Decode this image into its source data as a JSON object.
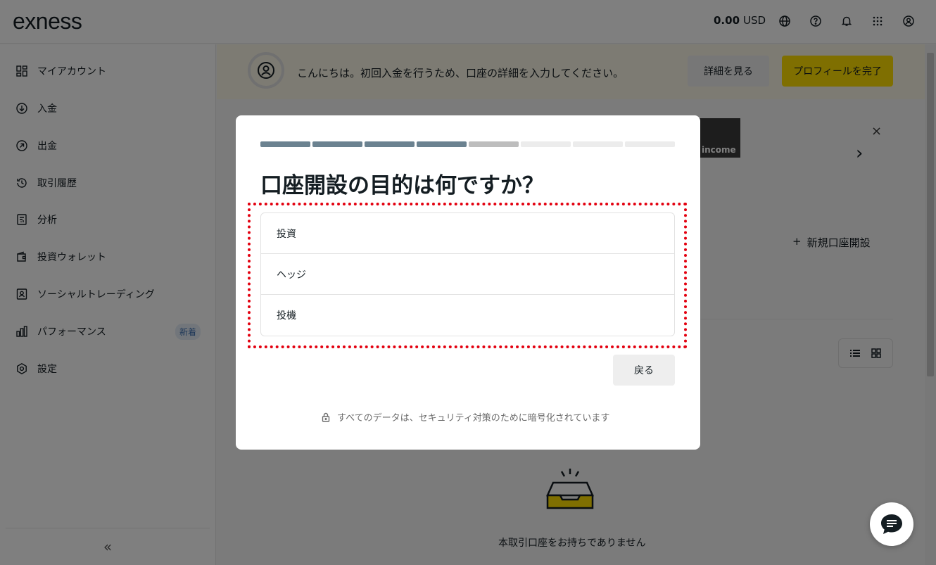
{
  "header": {
    "logo": "exness",
    "balance_amount": "0.00",
    "balance_currency": "USD",
    "icons": [
      "globe-icon",
      "help-icon",
      "bell-icon",
      "apps-grid-icon",
      "user-icon"
    ]
  },
  "sidebar": {
    "items": [
      {
        "label": "マイアカウント",
        "icon": "dashboard-icon"
      },
      {
        "label": "入金",
        "icon": "deposit-icon"
      },
      {
        "label": "出金",
        "icon": "withdraw-icon"
      },
      {
        "label": "取引履歴",
        "icon": "history-icon"
      },
      {
        "label": "分析",
        "icon": "analytics-icon"
      },
      {
        "label": "投資ウォレット",
        "icon": "wallet-icon"
      },
      {
        "label": "ソーシャルトレーディング",
        "icon": "social-trading-icon"
      },
      {
        "label": "パフォーマンス",
        "icon": "performance-icon",
        "badge": "新着"
      },
      {
        "label": "設定",
        "icon": "settings-icon"
      }
    ],
    "collapse_label": "«"
  },
  "banner": {
    "text": "こんにちは。初回入金を行うため、口座の詳細を入力してください。",
    "details_button": "詳細を見る",
    "profile_button": "プロフィールを完了"
  },
  "promo": {
    "image_text": "income",
    "close_label": "×",
    "next_label": "›"
  },
  "main": {
    "new_account_label": "新規口座開設",
    "empty_text": "本取引口座をお持ちでありません"
  },
  "modal": {
    "progress": {
      "total_steps": 8,
      "completed": 4,
      "current": 5
    },
    "colors": {
      "done": "#6b8290",
      "current": "#bdbdbd",
      "todo": "#ececec",
      "highlight": "#e3000f"
    },
    "title": "口座開設の目的は何ですか？",
    "options": [
      "投資",
      "ヘッジ",
      "投機"
    ],
    "back_button": "戻る",
    "security_note": "すべてのデータは、セキュリティ対策のために暗号化されています"
  }
}
